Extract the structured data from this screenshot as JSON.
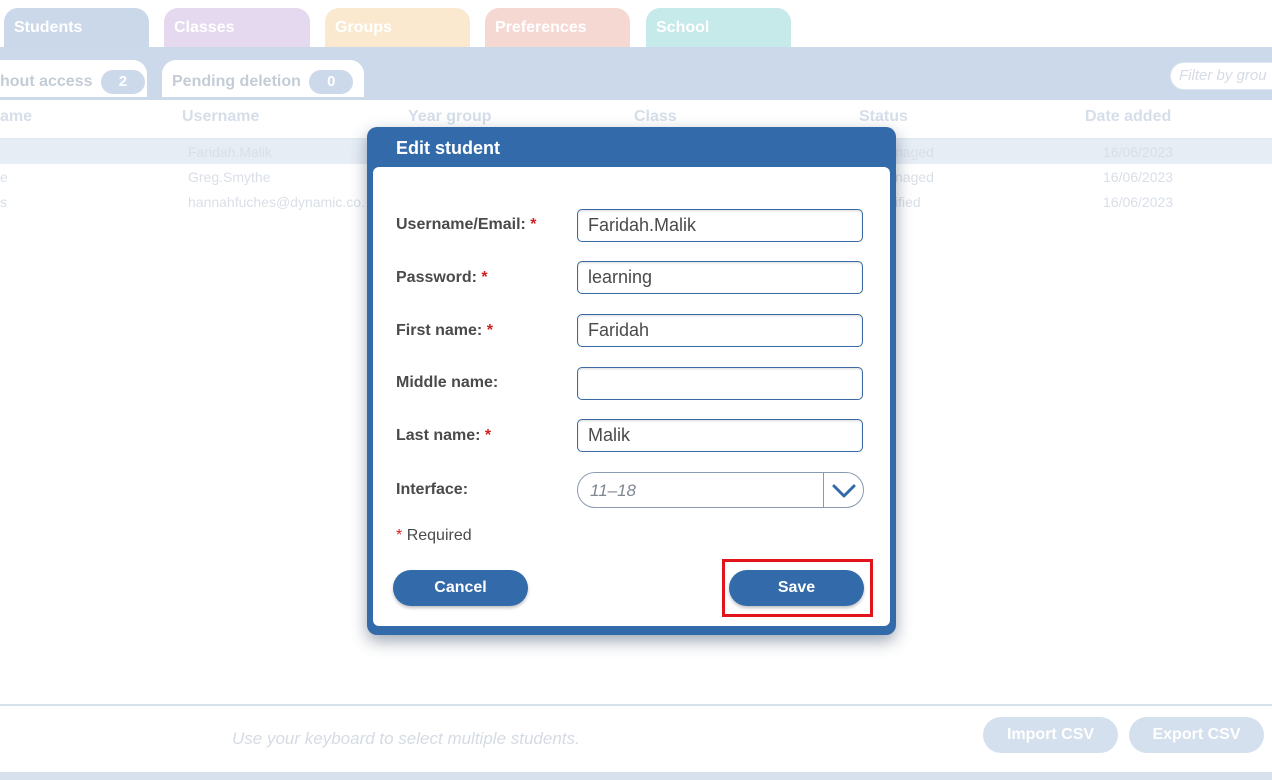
{
  "colors": {
    "modal_blue": "#336aaa",
    "required_red": "#d21f1f",
    "highlight_red": "#e2141b",
    "tab_students": "#cbd8ea",
    "tab_classes": "#e4d9ee",
    "tab_groups": "#fae8cf",
    "tab_preferences": "#f6d8d3",
    "tab_school": "#c6e9ea"
  },
  "tabs": [
    "Students",
    "Classes",
    "Groups",
    "Preferences",
    "School"
  ],
  "subtabs": [
    {
      "label": "hout access",
      "count": "2"
    },
    {
      "label": "Pending deletion",
      "count": "0"
    }
  ],
  "filter_placeholder": "Filter by grou",
  "columns": [
    "ame",
    "Username",
    "Year group",
    "Class",
    "Status",
    "Date added"
  ],
  "rows": [
    {
      "name": "",
      "username": "Faridah.Malik",
      "status": "naged",
      "date": "16/06/2023"
    },
    {
      "name": "e",
      "username": "Greg.Smythe",
      "status": "naged",
      "date": "16/06/2023"
    },
    {
      "name": "s",
      "username": "hannahfuches@dynamic.co.",
      "status": "ified",
      "date": "16/06/2023"
    }
  ],
  "footer": {
    "hint": "Use your keyboard to select multiple students.",
    "import_label": "Import CSV",
    "export_label": "Export CSV"
  },
  "modal": {
    "title": "Edit student",
    "fields": [
      {
        "label": "Username/Email:",
        "required": "*",
        "value": "Faridah.Malik"
      },
      {
        "label": "Password:",
        "required": "*",
        "value": "learning"
      },
      {
        "label": "First name:",
        "required": "*",
        "value": "Faridah"
      },
      {
        "label": "Middle name:",
        "required": "",
        "value": ""
      },
      {
        "label": "Last name:",
        "required": "*",
        "value": "Malik"
      }
    ],
    "interface_label": "Interface:",
    "interface_value": "11–18",
    "required_mark": "*",
    "required_note": "Required",
    "cancel_label": "Cancel",
    "save_label": "Save",
    "dropdown_icon": "chevron-down-icon"
  }
}
